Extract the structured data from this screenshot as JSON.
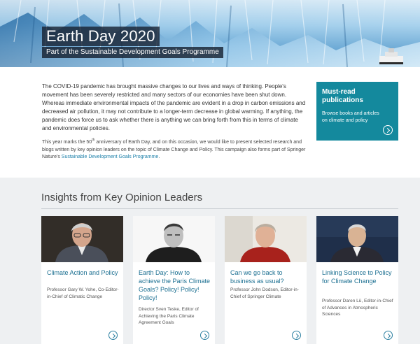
{
  "hero": {
    "title": "Earth Day 2020",
    "subtitle": "Part of the Sustainable Development Goals Programme"
  },
  "intro": {
    "lead": "The COVID-19 pandemic has brought massive changes to our lives and ways of thinking. People's movement has been severely restricted and many sectors of our economies have been shut down. Whereas immediate environmental impacts of the pandemic are evident in a drop in carbon emissions and decreased air pollution, it may not contribute to a longer-term decrease in global warming. If anything, the pandemic does force us to ask whether there is anything we can bring forth from this in terms of climate and environmental policies.",
    "secondary_before": "This year marks the 50",
    "secondary_sup": "th",
    "secondary_after": " anniversary of Earth Day, and on this occasion, we would like to present selected research and blogs written by key opinion leaders on the topic of Climate Change and Policy. This campaign also forms part of Springer Nature's ",
    "secondary_link": "Sustainable Development Goals Programme",
    "secondary_end": "."
  },
  "side_card": {
    "title": "Must-read publications",
    "description": "Browse books and articles on climate and policy"
  },
  "insights": {
    "heading": "Insights from Key Opinion Leaders",
    "cards": [
      {
        "title": "Climate Action and Policy",
        "author": "Professor Gary W. Yohe, Co-Editor-in-Chief of Climatic Change"
      },
      {
        "title": "Earth Day: How to achieve the Paris Climate Goals? Policy! Policy! Policy!",
        "author": "Director Sven Teske, Editor of Achieving the Paris Climate Agreement Goals"
      },
      {
        "title": "Can we go back to business as usual?",
        "author": "Professor John Dodson, Editor-in-Chief of Springer Climate"
      },
      {
        "title": "Linking Science to Policy for Climate Change",
        "author": "Professor Daren Lü, Editor-in-Chief of Advances in Atmospheric Sciences"
      }
    ]
  },
  "colors": {
    "accent_teal": "#14899d",
    "link_blue": "#1b6f91",
    "section_bg": "#eef0f2"
  }
}
